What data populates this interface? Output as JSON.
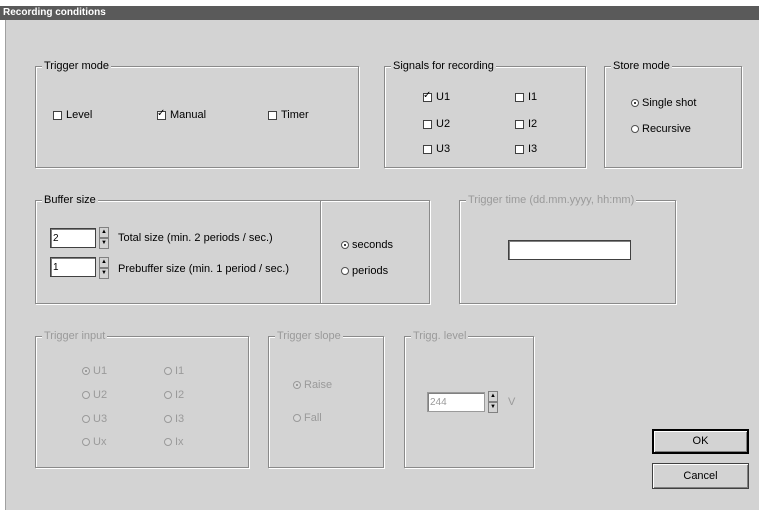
{
  "window": {
    "title": "Recording conditions"
  },
  "trigger_mode": {
    "label": "Trigger mode",
    "options": [
      {
        "label": "Level",
        "checked": false
      },
      {
        "label": "Manual",
        "checked": true
      },
      {
        "label": "Timer",
        "checked": false
      }
    ]
  },
  "signals": {
    "label": "Signals for recording",
    "items": [
      {
        "label": "U1",
        "checked": true
      },
      {
        "label": "I1",
        "checked": false
      },
      {
        "label": "U2",
        "checked": false
      },
      {
        "label": "I2",
        "checked": false
      },
      {
        "label": "U3",
        "checked": false
      },
      {
        "label": "I3",
        "checked": false
      }
    ]
  },
  "store_mode": {
    "label": "Store mode",
    "options": [
      {
        "label": "Single shot",
        "selected": true
      },
      {
        "label": "Recursive",
        "selected": false
      }
    ]
  },
  "buffer_size": {
    "label": "Buffer size",
    "total_value": "2",
    "total_label": "Total size (min. 2 periods / sec.)",
    "prebuffer_value": "1",
    "prebuffer_label": "Prebuffer size (min. 1 period / sec.)",
    "unit_options": [
      {
        "label": "seconds",
        "selected": true
      },
      {
        "label": "periods",
        "selected": false
      }
    ]
  },
  "trigger_time": {
    "label": "Trigger time (dd.mm.yyyy, hh:mm)",
    "value": ""
  },
  "trigger_input": {
    "label": "Trigger input",
    "options": [
      {
        "label": "U1",
        "selected": true
      },
      {
        "label": "I1",
        "selected": false
      },
      {
        "label": "U2",
        "selected": false
      },
      {
        "label": "I2",
        "selected": false
      },
      {
        "label": "U3",
        "selected": false
      },
      {
        "label": "I3",
        "selected": false
      },
      {
        "label": "Ux",
        "selected": false
      },
      {
        "label": "Ix",
        "selected": false
      }
    ]
  },
  "trigger_slope": {
    "label": "Trigger slope",
    "options": [
      {
        "label": "Raise",
        "selected": true
      },
      {
        "label": "Fall",
        "selected": false
      }
    ]
  },
  "trigg_level": {
    "label": "Trigg. level",
    "value": "244",
    "unit": "V"
  },
  "buttons": {
    "ok": "OK",
    "cancel": "Cancel"
  },
  "colors": {
    "dialog_bg": "#d3d3d3",
    "titlebar_bg": "#5a5a5a",
    "disabled_text": "#9a9a9a"
  }
}
